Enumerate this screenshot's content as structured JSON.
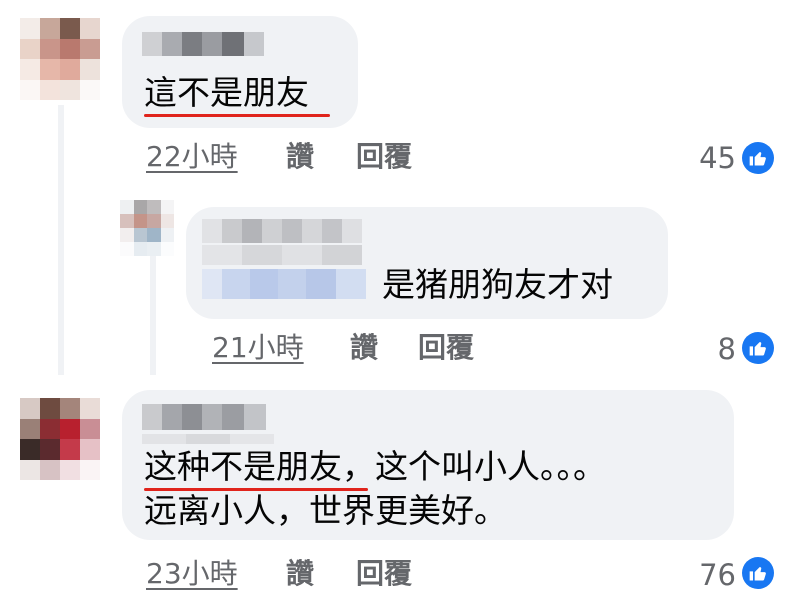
{
  "comments": [
    {
      "text": "這不是朋友",
      "time": "22小時",
      "like_label": "讚",
      "reply_label": "回覆",
      "reaction_count": "45"
    },
    {
      "text": "是猪朋狗友才对",
      "time": "21小時",
      "like_label": "讚",
      "reply_label": "回覆",
      "reaction_count": "8"
    },
    {
      "text_line1_highlight": "这种不是朋友",
      "text_line1_rest": "，这个叫小人。。。",
      "text_line2": "远离小人，世界更美好。",
      "time": "23小時",
      "like_label": "讚",
      "reply_label": "回覆",
      "reaction_count": "76"
    }
  ],
  "colors": {
    "bubble": "#f0f2f5",
    "meta_text": "#65676b",
    "like_blue": "#1877f2",
    "underline_red": "#e0241c"
  },
  "icons": {
    "reaction": "thumbs-up-icon",
    "avatar": "pixelated-avatar"
  }
}
